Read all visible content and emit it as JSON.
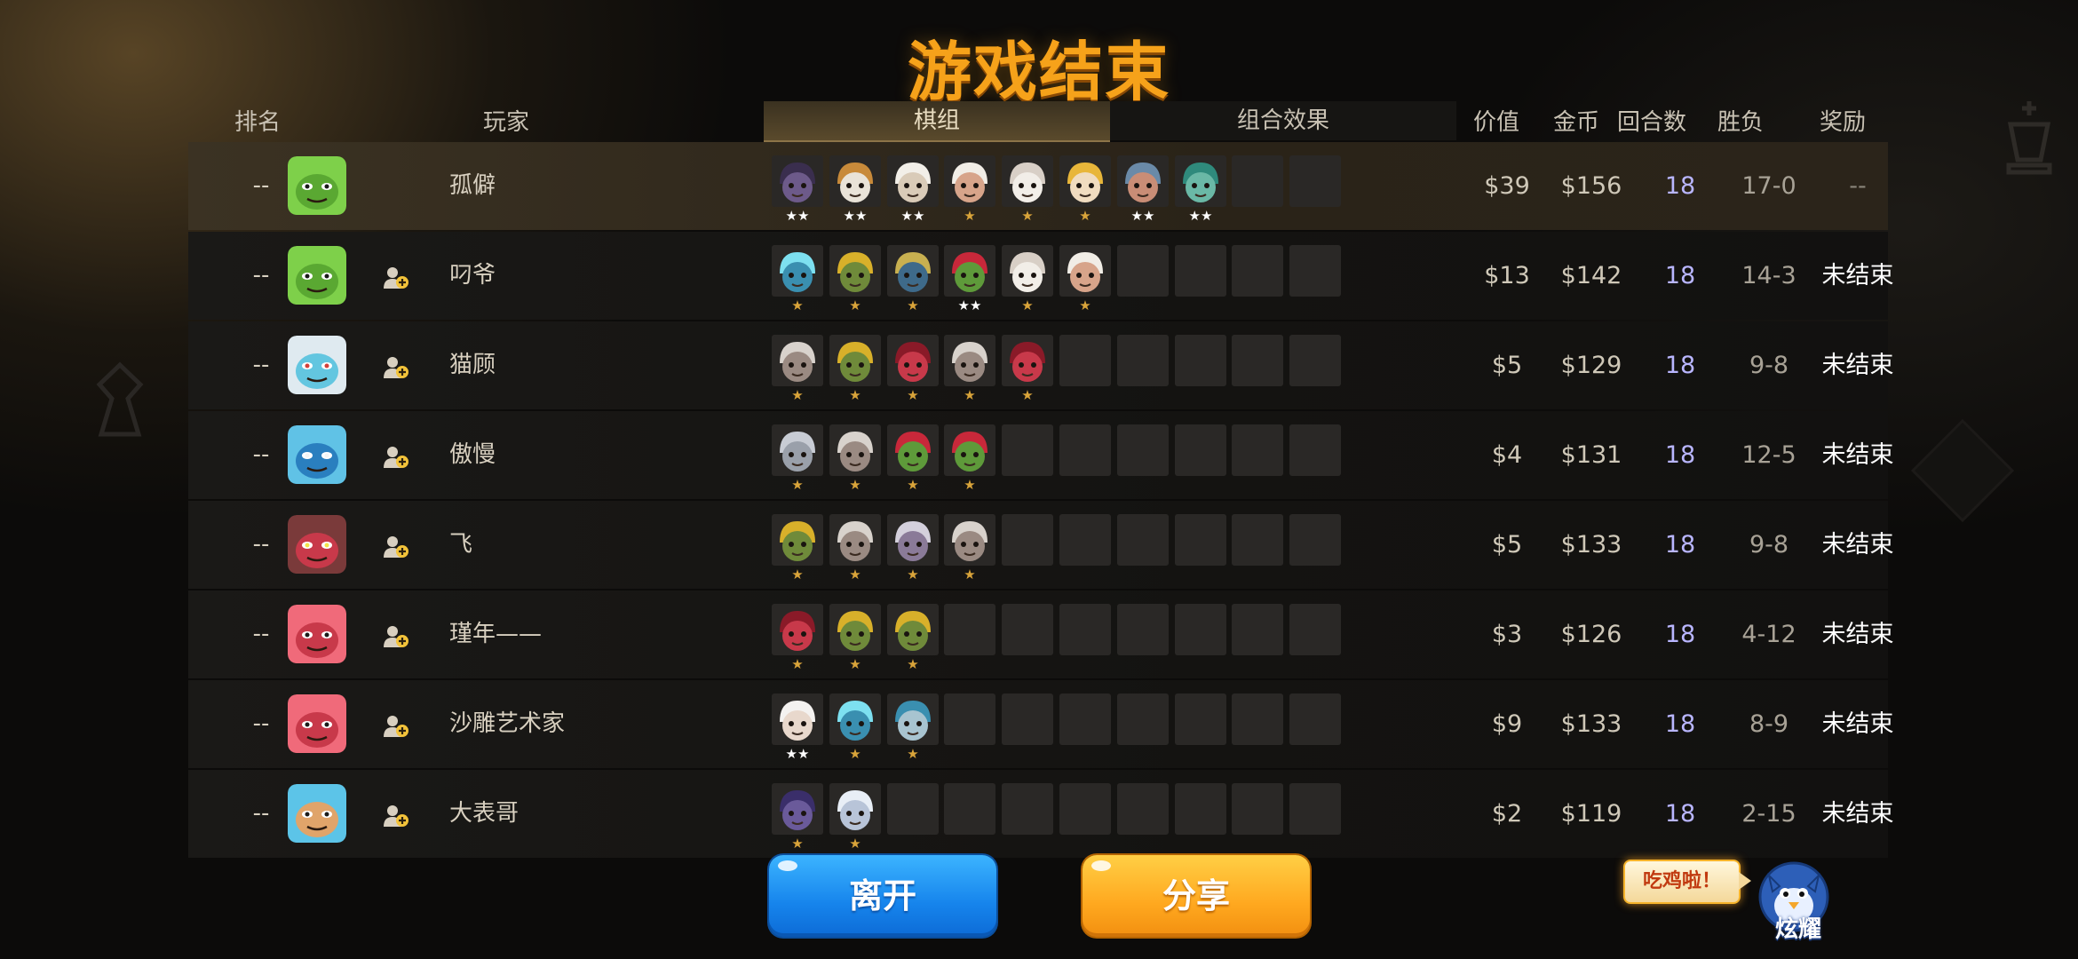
{
  "title": "游戏结束",
  "headers": {
    "rank": "排名",
    "player": "玩家",
    "deck": "棋组",
    "combo": "组合效果",
    "value": "价值",
    "gold": "金币",
    "rounds": "回合数",
    "win_loss": "胜负",
    "reward": "奖励"
  },
  "colors": {
    "title": "#f6a21a",
    "rounds_text": "#b9b6ff",
    "star_gold": "#d9a43a",
    "star_white": "#ffffff",
    "leave_button": "#1684ec",
    "share_button": "#ffa81f"
  },
  "players": [
    {
      "rank": "--",
      "avatar": "green-goblin-avatar",
      "name": "孤僻",
      "value": "$39",
      "gold": "$156",
      "rounds": "18",
      "wl": "17-0",
      "reward": "--",
      "is_self": true,
      "units": [
        {
          "icon": "hooded-assassin",
          "stars": 2
        },
        {
          "icon": "white-wolf",
          "stars": 2
        },
        {
          "icon": "white-haired-warrior",
          "stars": 2
        },
        {
          "icon": "old-sage",
          "stars": 1
        },
        {
          "icon": "white-beast",
          "stars": 1
        },
        {
          "icon": "golden-priest",
          "stars": 1
        },
        {
          "icon": "goggled-dwarf",
          "stars": 2
        },
        {
          "icon": "teal-elf",
          "stars": 2
        }
      ]
    },
    {
      "rank": "--",
      "avatar": "green-goblin-avatar",
      "name": "叼爷",
      "value": "$13",
      "gold": "$142",
      "rounds": "18",
      "wl": "14-3",
      "reward": "未结束",
      "is_self": false,
      "units": [
        {
          "icon": "cyan-knight",
          "stars": 1
        },
        {
          "icon": "goblin-engineer",
          "stars": 1
        },
        {
          "icon": "mech-pilot",
          "stars": 1
        },
        {
          "icon": "bandana-goblin",
          "stars": 2
        },
        {
          "icon": "white-beast",
          "stars": 1
        },
        {
          "icon": "old-sage",
          "stars": 1
        }
      ]
    },
    {
      "rank": "--",
      "avatar": "yeti-avatar",
      "name": "猫顾",
      "value": "$5",
      "gold": "$129",
      "rounds": "18",
      "wl": "9-8",
      "reward": "未结束",
      "is_self": false,
      "units": [
        {
          "icon": "grey-monk",
          "stars": 1
        },
        {
          "icon": "goblin-engineer",
          "stars": 1
        },
        {
          "icon": "red-ogre",
          "stars": 1
        },
        {
          "icon": "grey-monk",
          "stars": 1
        },
        {
          "icon": "red-ogre",
          "stars": 1
        }
      ]
    },
    {
      "rank": "--",
      "avatar": "frost-dragon-avatar",
      "name": "傲慢",
      "value": "$4",
      "gold": "$131",
      "rounds": "18",
      "wl": "12-5",
      "reward": "未结束",
      "is_self": false,
      "units": [
        {
          "icon": "grey-elephant",
          "stars": 1
        },
        {
          "icon": "grey-monk",
          "stars": 1
        },
        {
          "icon": "bandana-goblin",
          "stars": 1
        },
        {
          "icon": "bandana-goblin",
          "stars": 1
        }
      ]
    },
    {
      "rank": "--",
      "avatar": "red-ogre-avatar",
      "name": "飞",
      "value": "$5",
      "gold": "$133",
      "rounds": "18",
      "wl": "9-8",
      "reward": "未结束",
      "is_self": false,
      "units": [
        {
          "icon": "goblin-engineer",
          "stars": 1
        },
        {
          "icon": "grey-monk",
          "stars": 1
        },
        {
          "icon": "purple-monk",
          "stars": 1
        },
        {
          "icon": "grey-monk",
          "stars": 1
        }
      ]
    },
    {
      "rank": "--",
      "avatar": "pink-beast-avatar",
      "name": "瑾年——",
      "value": "$3",
      "gold": "$126",
      "rounds": "18",
      "wl": "4-12",
      "reward": "未结束",
      "is_self": false,
      "units": [
        {
          "icon": "red-ogre",
          "stars": 1
        },
        {
          "icon": "goblin-engineer",
          "stars": 1
        },
        {
          "icon": "goblin-engineer",
          "stars": 1
        }
      ]
    },
    {
      "rank": "--",
      "avatar": "pink-beast-avatar",
      "name": "沙雕艺术家",
      "value": "$9",
      "gold": "$133",
      "rounds": "18",
      "wl": "8-9",
      "reward": "未结束",
      "is_self": false,
      "units": [
        {
          "icon": "white-haired-lady",
          "stars": 2
        },
        {
          "icon": "cyan-knight",
          "stars": 1
        },
        {
          "icon": "armored-beast",
          "stars": 1
        }
      ]
    },
    {
      "rank": "--",
      "avatar": "blue-hair-avatar",
      "name": "大表哥",
      "value": "$2",
      "gold": "$119",
      "rounds": "18",
      "wl": "2-15",
      "reward": "未结束",
      "is_self": false,
      "units": [
        {
          "icon": "bat-demon",
          "stars": 1
        },
        {
          "icon": "horned-spirit",
          "stars": 1
        }
      ]
    }
  ],
  "buttons": {
    "leave": "离开",
    "share": "分享"
  },
  "bubble_text": "吃鸡啦！",
  "flaunt_label": "炫耀"
}
